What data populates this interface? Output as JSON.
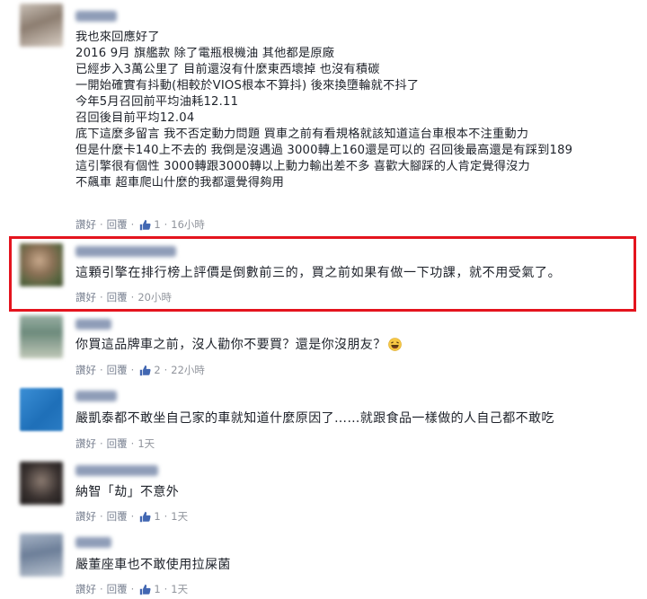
{
  "comments": [
    {
      "lines": [
        "我也來回應好了",
        "2016 9月 旗艦款 除了電瓶根機油 其他都是原廠",
        "已經步入3萬公里了 目前還沒有什麼東西壞掉 也沒有積碳",
        "一開始確實有抖動(相較於VIOS根本不算抖) 後來換墮輪就不抖了",
        "今年5月召回前平均油耗12.11",
        "召回後目前平均12.04",
        "底下這麼多留言 我不否定動力問題 買車之前有看規格就該知道這台車根本不注重動力",
        "但是什麼卡140上不去的 我倒是沒遇過 3000轉上160還是可以的 召回後最高還是有踩到189",
        "這引擎很有個性 3000轉跟3000轉以上動力輸出差不多 喜歡大腳踩的人肯定覺得沒力",
        "不飆車 超車爬山什麼的我都還覺得夠用"
      ],
      "like": "讚好",
      "reply": "回覆",
      "likes": "1",
      "time": "16小時"
    },
    {
      "lines": [
        "這顆引擎在排行榜上評價是倒數前三的，買之前如果有做一下功課，就不用受氣了。"
      ],
      "like": "讚好",
      "reply": "回覆",
      "time": "20小時"
    },
    {
      "lines": [
        "你買這品牌車之前，沒人勸你不要買？還是你沒朋友？"
      ],
      "like": "讚好",
      "reply": "回覆",
      "likes": "2",
      "time": "22小時"
    },
    {
      "lines": [
        "嚴凱泰都不敢坐自己家的車就知道什麼原因了……就跟食品一樣做的人自己都不敢吃"
      ],
      "like": "讚好",
      "reply": "回覆",
      "time": "1天"
    },
    {
      "lines": [
        "納智「劫」不意外"
      ],
      "like": "讚好",
      "reply": "回覆",
      "likes": "1",
      "time": "1天"
    },
    {
      "lines": [
        "嚴董座車也不敢使用拉屎菌"
      ],
      "like": "讚好",
      "reply": "回覆",
      "likes": "1",
      "time": "1天"
    }
  ],
  "colors": {
    "highlight_border": "#e4141e",
    "like_blue": "#4267b2",
    "meta_gray": "#90949c"
  },
  "icons": {
    "like": "thumbs-up-icon",
    "emoji": "laughing-emoji-icon"
  }
}
